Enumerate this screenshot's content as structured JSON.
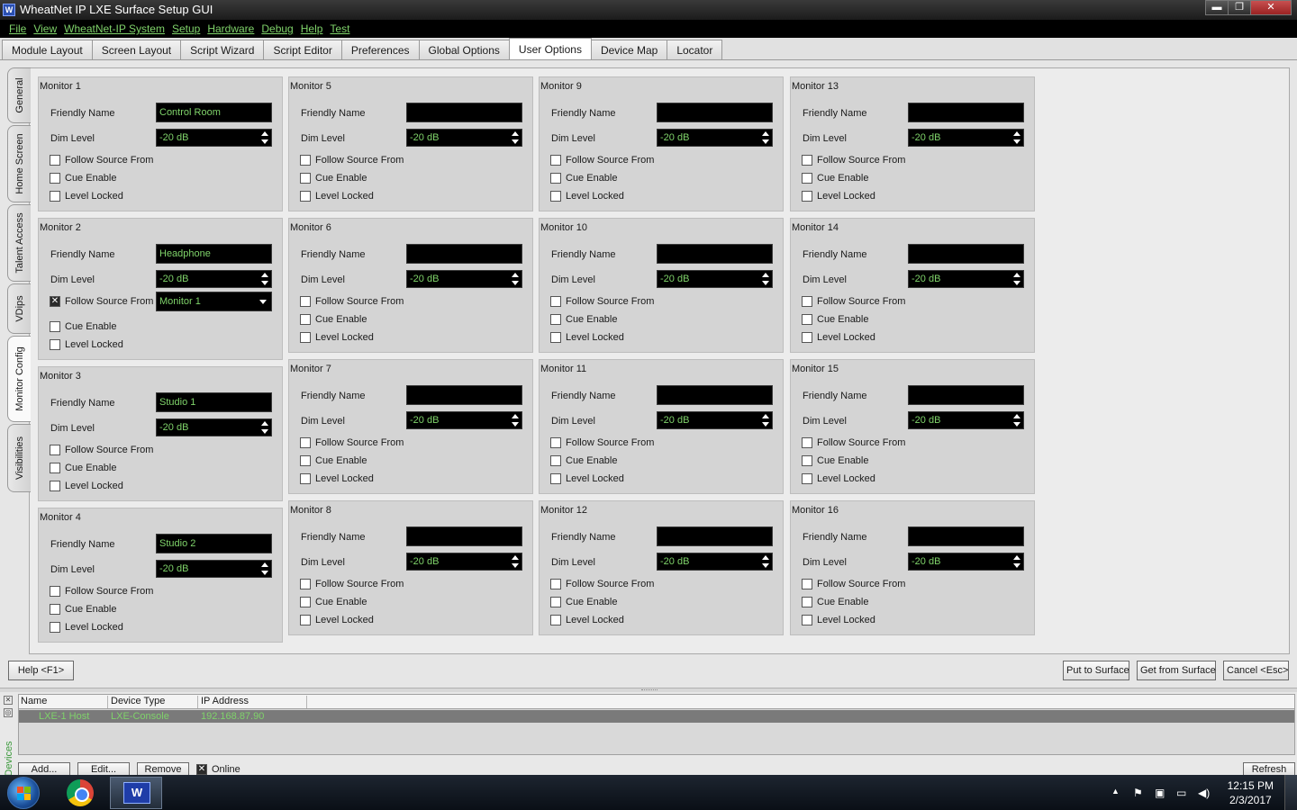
{
  "window": {
    "title": "WheatNet IP LXE Surface Setup GUI",
    "app_icon_glyph": "W",
    "minimize": "▬",
    "maximize": "❐",
    "close": "✕"
  },
  "menu": [
    "File",
    "View",
    "WheatNet-IP System",
    "Setup",
    "Hardware",
    "Debug",
    "Help",
    "Test"
  ],
  "tabs": [
    {
      "label": "Module Layout",
      "active": false
    },
    {
      "label": "Screen Layout",
      "active": false
    },
    {
      "label": "Script Wizard",
      "active": false
    },
    {
      "label": "Script Editor",
      "active": false
    },
    {
      "label": "Preferences",
      "active": false
    },
    {
      "label": "Global Options",
      "active": false
    },
    {
      "label": "User Options",
      "active": true
    },
    {
      "label": "Device Map",
      "active": false
    },
    {
      "label": "Locator",
      "active": false
    }
  ],
  "side_tabs": [
    {
      "label": "General",
      "active": false
    },
    {
      "label": "Home Screen",
      "active": false
    },
    {
      "label": "Talent Access",
      "active": false
    },
    {
      "label": "VDips",
      "active": false
    },
    {
      "label": "Monitor Config",
      "active": true
    },
    {
      "label": "Visibilities",
      "active": false
    }
  ],
  "labels": {
    "friendly_name": "Friendly Name",
    "dim_level": "Dim Level",
    "follow_source": "Follow Source From",
    "cue_enable": "Cue Enable",
    "level_locked": "Level Locked"
  },
  "monitors": [
    {
      "title": "Monitor 1",
      "name": "Control Room",
      "dim": "-20 dB",
      "follow": false,
      "cue": false,
      "locked": false
    },
    {
      "title": "Monitor 2",
      "name": "Headphone",
      "dim": "-20 dB",
      "follow": true,
      "follow_value": "Monitor 1",
      "cue": false,
      "locked": false
    },
    {
      "title": "Monitor 3",
      "name": "Studio 1",
      "dim": "-20 dB",
      "follow": false,
      "cue": false,
      "locked": false
    },
    {
      "title": "Monitor 4",
      "name": "Studio 2",
      "dim": "-20 dB",
      "follow": false,
      "cue": false,
      "locked": false
    },
    {
      "title": "Monitor 5",
      "name": "",
      "dim": "-20 dB",
      "follow": false,
      "cue": false,
      "locked": false
    },
    {
      "title": "Monitor 6",
      "name": "",
      "dim": "-20 dB",
      "follow": false,
      "cue": false,
      "locked": false
    },
    {
      "title": "Monitor 7",
      "name": "",
      "dim": "-20 dB",
      "follow": false,
      "cue": false,
      "locked": false
    },
    {
      "title": "Monitor 8",
      "name": "",
      "dim": "-20 dB",
      "follow": false,
      "cue": false,
      "locked": false
    },
    {
      "title": "Monitor 9",
      "name": "",
      "dim": "-20 dB",
      "follow": false,
      "cue": false,
      "locked": false
    },
    {
      "title": "Monitor 10",
      "name": "",
      "dim": "-20 dB",
      "follow": false,
      "cue": false,
      "locked": false
    },
    {
      "title": "Monitor 11",
      "name": "",
      "dim": "-20 dB",
      "follow": false,
      "cue": false,
      "locked": false
    },
    {
      "title": "Monitor 12",
      "name": "",
      "dim": "-20 dB",
      "follow": false,
      "cue": false,
      "locked": false
    },
    {
      "title": "Monitor 13",
      "name": "",
      "dim": "-20 dB",
      "follow": false,
      "cue": false,
      "locked": false
    },
    {
      "title": "Monitor 14",
      "name": "",
      "dim": "-20 dB",
      "follow": false,
      "cue": false,
      "locked": false
    },
    {
      "title": "Monitor 15",
      "name": "",
      "dim": "-20 dB",
      "follow": false,
      "cue": false,
      "locked": false
    },
    {
      "title": "Monitor 16",
      "name": "",
      "dim": "-20 dB",
      "follow": false,
      "cue": false,
      "locked": false
    }
  ],
  "buttons": {
    "help": "Help <F1>",
    "put": "Put to Surface",
    "get": "Get from Surface",
    "cancel": "Cancel <Esc>"
  },
  "devices": {
    "pane_label": "Devices",
    "columns": [
      "Name",
      "Device Type",
      "IP Address"
    ],
    "rows": [
      {
        "name": "LXE-1 Host",
        "type": "LXE-Console",
        "ip": "192.168.87.90"
      }
    ],
    "add": "Add...",
    "edit": "Edit...",
    "remove": "Remove",
    "online_label": "Online",
    "online_checked": true,
    "refresh": "Refresh"
  },
  "taskbar": {
    "app_glyph": "W",
    "time": "12:15 PM",
    "date": "2/3/2017",
    "tray_icons": [
      "show-hidden-icon",
      "action-center-flag-icon",
      "usb-device-icon",
      "network-icon",
      "volume-icon"
    ]
  },
  "colors": {
    "field_text": "#7fd36a",
    "menu_text": "#7fd36a",
    "field_bg": "#000000"
  }
}
